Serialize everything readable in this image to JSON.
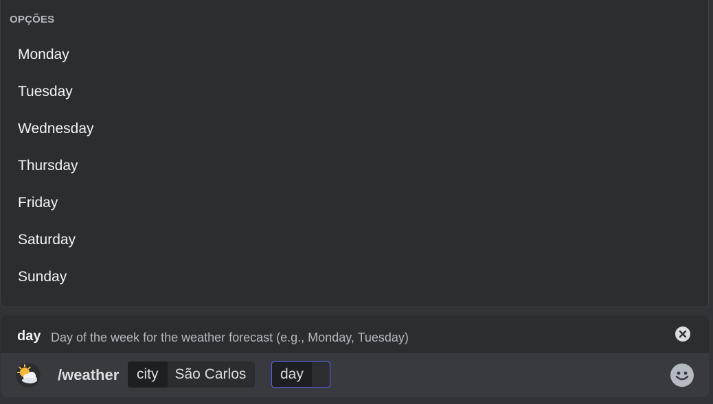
{
  "options": {
    "header": "OPÇÕES",
    "items": [
      "Monday",
      "Tuesday",
      "Wednesday",
      "Thursday",
      "Friday",
      "Saturday",
      "Sunday"
    ]
  },
  "hint": {
    "name": "day",
    "description": "Day of the week for the weather forecast (e.g., Monday, Tuesday)",
    "close_icon": "close-circle-icon"
  },
  "composer": {
    "app_icon": "weather-partly-cloudy-icon",
    "command": "/weather",
    "params": [
      {
        "name": "city",
        "value": "São Carlos"
      },
      {
        "name": "day",
        "value": ""
      }
    ],
    "emoji_icon": "emoji-smile-icon",
    "accent_color": "#5865f2"
  }
}
